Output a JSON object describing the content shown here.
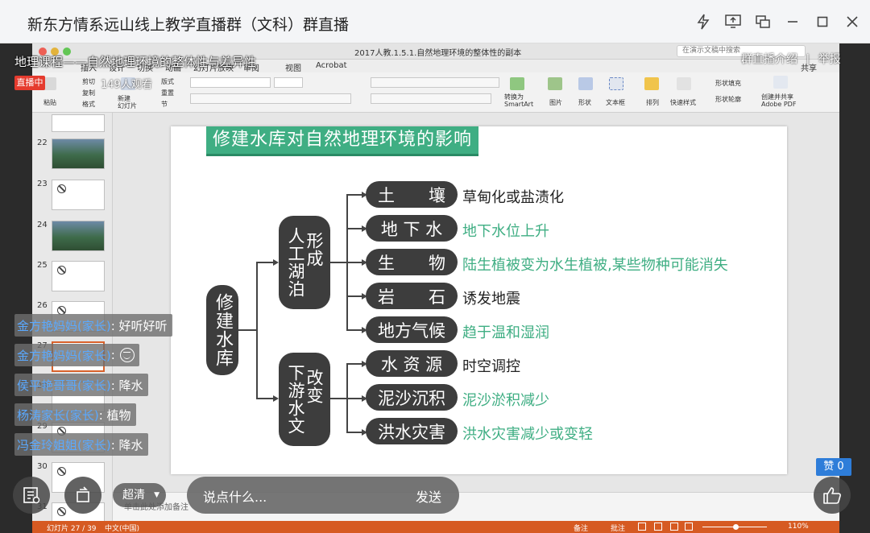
{
  "window": {
    "title": "新东方情系远山线上教学直播群（文科）群直播"
  },
  "ppt": {
    "doc_title": "2017人教.1.5.1.自然地理环境的整体性的副本",
    "search_placeholder": "在演示文稿中搜索",
    "menu": [
      "插入",
      "设计",
      "切换",
      "动画",
      "幻灯片放映",
      "审阅",
      "视图",
      "Acrobat"
    ],
    "share_label": "共享",
    "ribbon": {
      "paste": "粘贴",
      "cut": "剪切",
      "copy": "复制",
      "format": "格式",
      "new_slide": "新建\n幻灯片",
      "layout": "版式",
      "reset": "重置",
      "section": "节",
      "convert_smartart": "转换为\nSmartArt",
      "picture": "图片",
      "shape": "形状",
      "textbox": "文本框",
      "arrange": "排列",
      "quick_styles": "快速样式",
      "shape_fill": "形状填充",
      "shape_outline": "形状轮廓",
      "create_pdf": "创建并共享\nAdobe PDF"
    },
    "thumbnails": [
      {
        "num": "22",
        "kind": "photo"
      },
      {
        "num": "23",
        "kind": "blank"
      },
      {
        "num": "24",
        "kind": "photo"
      },
      {
        "num": "25",
        "kind": "blank"
      },
      {
        "num": "26",
        "kind": "blank"
      },
      {
        "num": "27",
        "kind": "selected"
      },
      {
        "num": "28",
        "kind": "blank"
      },
      {
        "num": "29",
        "kind": "blank"
      },
      {
        "num": "30",
        "kind": "blank"
      },
      {
        "num": "31",
        "kind": "blank"
      }
    ],
    "notes_placeholder": "单击此处添加备注",
    "status": {
      "slide_counter": "幻灯片 27 / 39",
      "language": "中文(中国)",
      "notes": "备注",
      "comments": "批注",
      "zoom": "110%"
    }
  },
  "slide": {
    "title": "修建水库对自然地理环境的影响",
    "root": "修建水库",
    "groups": [
      {
        "label_a": "人工湖泊",
        "label_b": "形成"
      },
      {
        "label_a": "下游水文",
        "label_b": "改变"
      }
    ],
    "items": [
      {
        "name": "土　　壤",
        "desc": "草甸化或盐渍化",
        "color": "dark"
      },
      {
        "name": "地 下 水",
        "desc": "地下水位上升",
        "color": "green"
      },
      {
        "name": "生　　物",
        "desc": "陆生植被变为水生植被,某些物种可能消失",
        "color": "green"
      },
      {
        "name": "岩　　石",
        "desc": "诱发地震",
        "color": "dark"
      },
      {
        "name": "地方气候",
        "desc": "趋于温和湿润",
        "color": "green"
      },
      {
        "name": "水 资 源",
        "desc": "时空调控",
        "color": "dark"
      },
      {
        "name": "泥沙沉积",
        "desc": "泥沙淤积减少",
        "color": "green"
      },
      {
        "name": "洪水灾害",
        "desc": "洪水灾害减少或变轻",
        "color": "green"
      }
    ],
    "colors": {
      "accent": "#3fae83",
      "pill": "#3d3d3d"
    }
  },
  "live": {
    "course_title": "地理课程——自然地理环境的整体性与差异性",
    "live_badge": "直播中",
    "viewers": "149人观看",
    "intro_link": "群直播介绍",
    "separator": "|",
    "report_link": "举报",
    "chat": [
      {
        "name": "金方艳妈妈(家长)",
        "msg": ": 好听好听"
      },
      {
        "name": "金方艳妈妈(家长)",
        "msg": ":",
        "emoji": "smile-face"
      },
      {
        "name": "侯平艳哥哥(家长)",
        "msg": ": 降水"
      },
      {
        "name": "杨涛家长(家长)",
        "msg": ": 植物"
      },
      {
        "name": "冯金玲姐姐(家长)",
        "msg": ": 降水"
      }
    ],
    "quality": "超清",
    "input_placeholder": "说点什么...",
    "send": "发送",
    "likes": "赞 0"
  }
}
